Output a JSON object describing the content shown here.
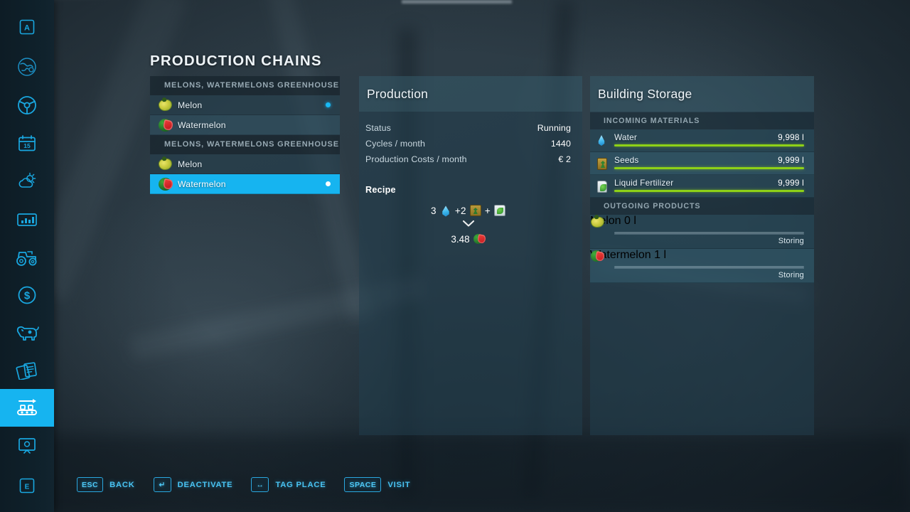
{
  "sidebar": {
    "items": [
      {
        "name": "sidebar-item-overview",
        "icon": "letter-a-icon",
        "label": "A",
        "active": false
      },
      {
        "name": "sidebar-item-map",
        "icon": "globe-map-icon",
        "label": "",
        "active": false
      },
      {
        "name": "sidebar-item-vehicles",
        "icon": "steering-wheel-icon",
        "label": "",
        "active": false
      },
      {
        "name": "sidebar-item-calendar",
        "icon": "calendar-15-icon",
        "label": "15",
        "active": false
      },
      {
        "name": "sidebar-item-weather",
        "icon": "sun-cloud-icon",
        "label": "",
        "active": false
      },
      {
        "name": "sidebar-item-statistics",
        "icon": "bar-chart-icon",
        "label": "",
        "active": false
      },
      {
        "name": "sidebar-item-machines",
        "icon": "tractor-icon",
        "label": "",
        "active": false
      },
      {
        "name": "sidebar-item-finances",
        "icon": "dollar-coin-icon",
        "label": "",
        "active": false
      },
      {
        "name": "sidebar-item-animals",
        "icon": "cow-icon",
        "label": "",
        "active": false
      },
      {
        "name": "sidebar-item-contracts",
        "icon": "documents-icon",
        "label": "",
        "active": false
      },
      {
        "name": "sidebar-item-production",
        "icon": "conveyor-belt-icon",
        "label": "",
        "active": true
      },
      {
        "name": "sidebar-item-gallery",
        "icon": "monitor-picture-icon",
        "label": "",
        "active": false
      },
      {
        "name": "sidebar-item-settings",
        "icon": "letter-e-icon",
        "label": "E",
        "active": false
      }
    ]
  },
  "page": {
    "title": "PRODUCTION CHAINS"
  },
  "chain_list": {
    "groups": [
      {
        "header": "MELONS, WATERMELONS GREENHOUSE",
        "items": [
          {
            "icon": "melon-icon",
            "label": "Melon",
            "selected": false,
            "indicator": "active-dot"
          },
          {
            "icon": "watermelon-icon",
            "label": "Watermelon",
            "selected": false,
            "indicator": ""
          }
        ]
      },
      {
        "header": "MELONS, WATERMELONS GREENHOUSE",
        "items": [
          {
            "icon": "melon-icon",
            "label": "Melon",
            "selected": false,
            "indicator": ""
          },
          {
            "icon": "watermelon-icon",
            "label": "Watermelon",
            "selected": true,
            "indicator": "active-dot"
          }
        ]
      }
    ]
  },
  "production": {
    "title": "Production",
    "rows": [
      {
        "key": "Status",
        "value": "Running"
      },
      {
        "key": "Cycles / month",
        "value": "1440"
      },
      {
        "key": "Production Costs / month",
        "value": "€ 2"
      }
    ],
    "recipe_title": "Recipe",
    "recipe_inputs": [
      {
        "amount": "3",
        "icon": "water-icon",
        "plus": false
      },
      {
        "amount": "+2",
        "icon": "seeds-icon",
        "plus": false
      },
      {
        "amount": "+",
        "icon": "liquid-fertilizer-icon",
        "plus": false
      }
    ],
    "recipe_arrow": "chevron-down-icon",
    "recipe_output": {
      "amount": "3.48",
      "icon": "watermelon-icon"
    }
  },
  "storage": {
    "title": "Building Storage",
    "incoming_header": "INCOMING MATERIALS",
    "incoming": [
      {
        "icon": "water-icon",
        "name": "Water",
        "value": "9,998 l",
        "fill": 100
      },
      {
        "icon": "seeds-icon",
        "name": "Seeds",
        "value": "9,999 l",
        "fill": 100
      },
      {
        "icon": "liquid-fertilizer-icon",
        "name": "Liquid Fertilizer",
        "value": "9,999 l",
        "fill": 100
      }
    ],
    "outgoing_header": "OUTGOING PRODUCTS",
    "outgoing": [
      {
        "icon": "melon-icon",
        "name": "Melon",
        "value": "0 l",
        "fill": 2,
        "state": "Storing"
      },
      {
        "icon": "watermelon-icon",
        "name": "Watermelon",
        "value": "1 l",
        "fill": 2,
        "state": "Storing"
      }
    ]
  },
  "help_bar": {
    "items": [
      {
        "key": "ESC",
        "label": "BACK"
      },
      {
        "key": "↵",
        "label": "DEACTIVATE"
      },
      {
        "key": "↔",
        "label": "TAG PLACE"
      },
      {
        "key": "SPACE",
        "label": "VISIT"
      }
    ]
  },
  "colors": {
    "accent": "#16b4f0",
    "bar_green": "#8ed117",
    "panel_header": "#34566633",
    "text_primary": "#eef4f8",
    "text_muted": "#97a9b3"
  }
}
